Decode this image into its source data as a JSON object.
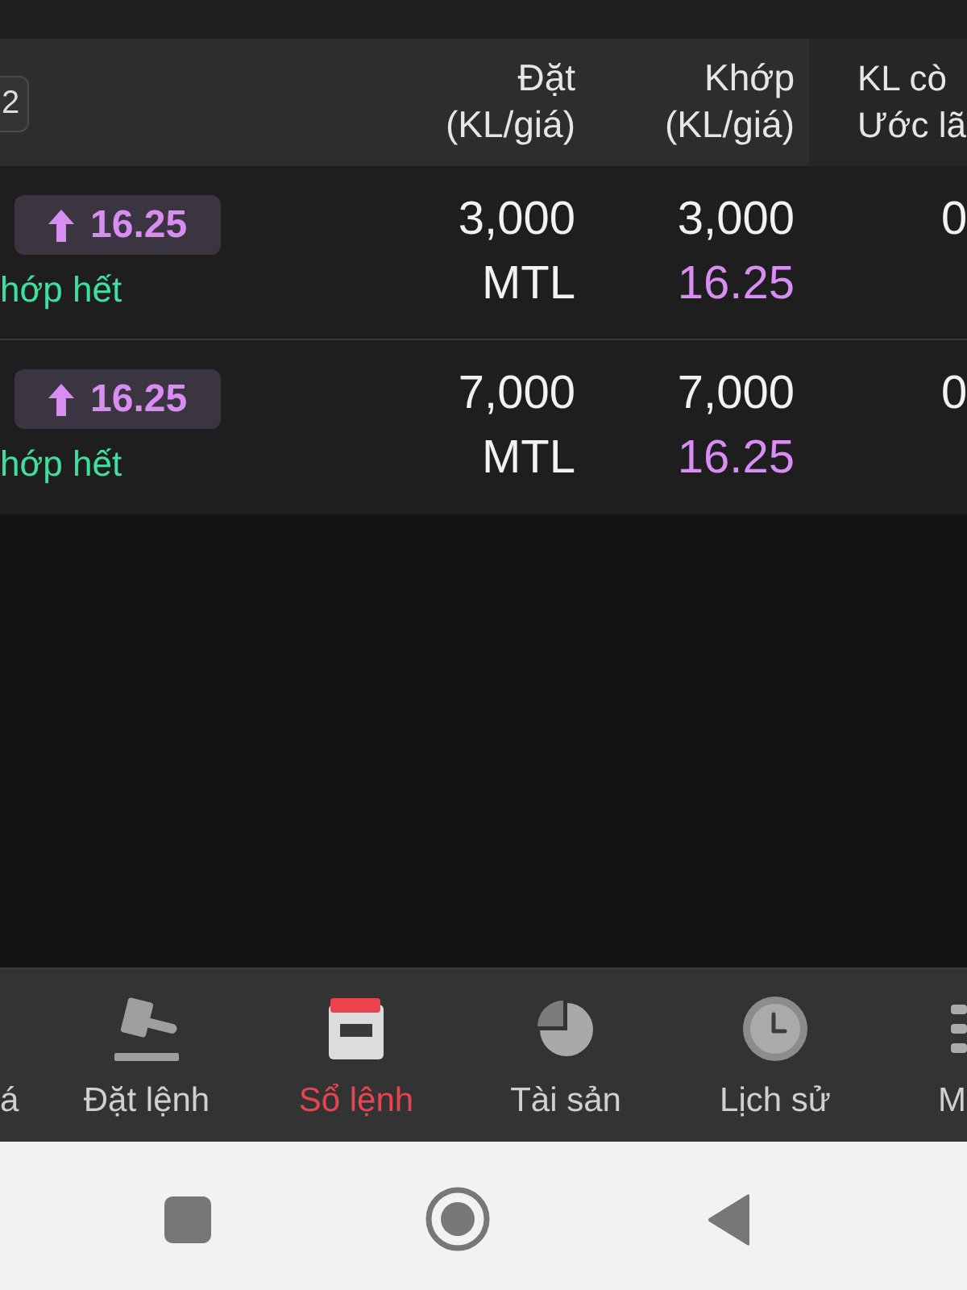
{
  "table": {
    "header_badge": "2",
    "columns": [
      {
        "lines": [
          "Đặt",
          "(KL/giá)"
        ]
      },
      {
        "lines": [
          "Khớp",
          "(KL/giá)"
        ]
      },
      {
        "lines": [
          "KL cò",
          "Ước lã"
        ]
      }
    ],
    "rows": [
      {
        "price_badge": {
          "value": "16.25"
        },
        "status": "hớp hết",
        "order": {
          "quantity": "3,000",
          "price": "MTL"
        },
        "matched": {
          "quantity": "3,000",
          "price": "16.25"
        },
        "column_3": "0"
      },
      {
        "price_badge": {
          "value": "16.25"
        },
        "status": "hớp hết",
        "order": {
          "quantity": "7,000",
          "price": "MTL"
        },
        "matched": {
          "quantity": "7,000",
          "price": "16.25"
        },
        "column_3": "0"
      }
    ]
  },
  "bottom_nav": {
    "items": [
      {
        "label": "á",
        "selected": false
      },
      {
        "label": "Đặt lệnh",
        "selected": false
      },
      {
        "label": "Sổ lệnh",
        "selected": true
      },
      {
        "label": "Tài sản",
        "selected": false
      },
      {
        "label": "Lịch sử",
        "selected": false
      },
      {
        "label": "M",
        "selected": false
      }
    ]
  }
}
